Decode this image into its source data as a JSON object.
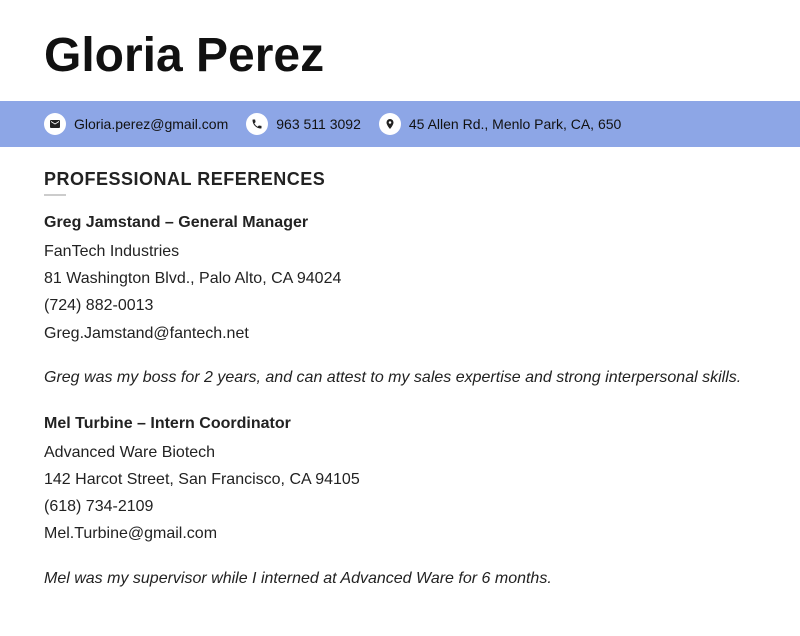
{
  "name": "Gloria Perez",
  "contact": {
    "email": "Gloria.perez@gmail.com",
    "phone": "963 511 3092",
    "address": "45 Allen Rd., Menlo Park, CA, 650"
  },
  "section_title": "PROFESSIONAL REFERENCES",
  "references": [
    {
      "heading": "Greg Jamstand – General Manager",
      "company": "FanTech Industries",
      "address": "81 Washington Blvd., Palo Alto, CA 94024",
      "phone": "(724) 882-0013",
      "email": "Greg.Jamstand@fantech.net",
      "note": "Greg was my boss for 2 years, and can attest to my sales expertise and strong interpersonal skills."
    },
    {
      "heading": "Mel Turbine – Intern Coordinator",
      "company": "Advanced Ware Biotech",
      "address": "142 Harcot Street, San Francisco, CA 94105",
      "phone": "(618) 734-2109",
      "email": "Mel.Turbine@gmail.com",
      "note": "Mel was my supervisor while I interned at Advanced Ware for 6 months."
    }
  ]
}
